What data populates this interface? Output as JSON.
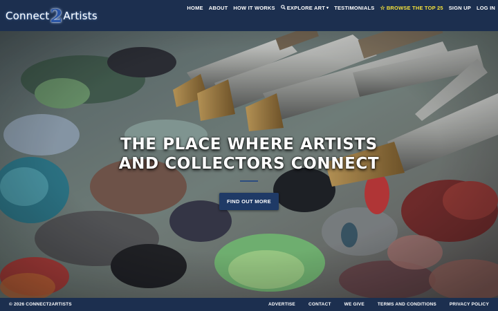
{
  "brand": {
    "logo_left": "Connect",
    "logo_mid": "2",
    "logo_right": "Artists"
  },
  "nav": {
    "items": [
      {
        "label": "HOME"
      },
      {
        "label": "ABOUT"
      },
      {
        "label": "HOW IT WORKS"
      },
      {
        "label": "EXPLORE ART",
        "icon": "search-icon",
        "dropdown": true
      },
      {
        "label": "TESTIMONIALS"
      },
      {
        "label": "BROWSE THE TOP 25",
        "icon": "star-icon",
        "accent": "#f5e23a"
      },
      {
        "label": "SIGN UP"
      },
      {
        "label": "LOG IN"
      }
    ]
  },
  "hero": {
    "title_line1": "THE PLACE WHERE ARTISTS",
    "title_line2": "AND COLLECTORS CONNECT",
    "cta_label": "FIND OUT MORE",
    "image": "oil-paint-palette-with-brushes"
  },
  "footer": {
    "copyright": "© 2026 CONNECT2ARTISTS",
    "links": [
      {
        "label": "ADVERTISE"
      },
      {
        "label": "CONTACT"
      },
      {
        "label": "WE GIVE"
      },
      {
        "label": "TERMS AND CONDITIONS"
      },
      {
        "label": "PRIVACY POLICY"
      }
    ]
  },
  "colors": {
    "header_bg": "#1c2f4f",
    "cta_bg": "#1f3a66",
    "accent_yellow": "#f5e23a"
  }
}
